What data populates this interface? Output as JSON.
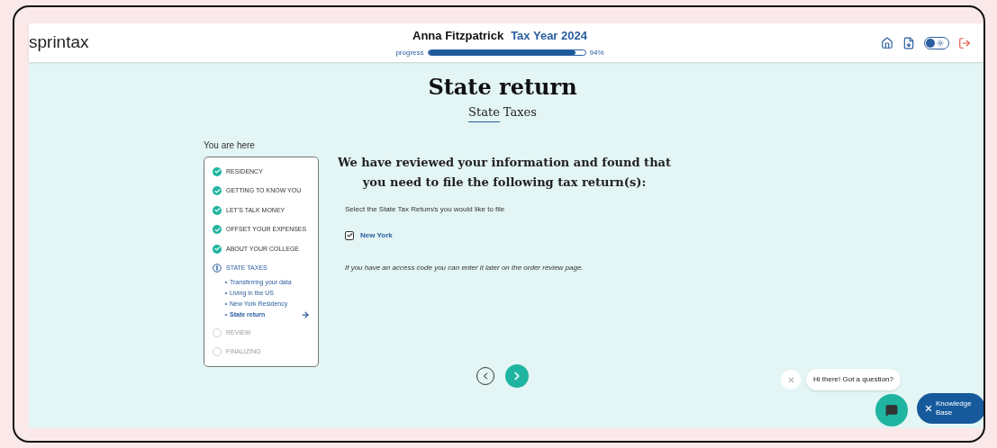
{
  "header": {
    "logo": "sprintax",
    "user_name": "Anna Fitzpatrick",
    "tax_year": "Tax Year 2024",
    "progress_label": "progress",
    "progress": {
      "level": 0.94
    },
    "progress_reading": "94%",
    "theme_toggle": {
      "on": false
    }
  },
  "sidebar": {
    "title": "You are here",
    "steps": [
      {
        "label": "RESIDENCY",
        "kind": "done"
      },
      {
        "label": "GETTING TO KNOW YOU",
        "kind": "done"
      },
      {
        "label": "LET'S TALK MONEY",
        "kind": "done"
      },
      {
        "label": "OFFSET YOUR EXPENSES",
        "kind": "done"
      },
      {
        "label": "ABOUT YOUR COLLEGE",
        "kind": "done"
      },
      {
        "label": "STATE TAXES",
        "kind": "current",
        "children": [
          {
            "label": "Transferring your data",
            "selected": false
          },
          {
            "label": "Living in the US",
            "selected": false
          },
          {
            "label": "New York Residency",
            "selected": false
          },
          {
            "label": "State return",
            "selected": true
          }
        ]
      },
      {
        "label": "REVIEW",
        "kind": "pending"
      },
      {
        "label": "FINALIZING",
        "kind": "pending"
      }
    ]
  },
  "main": {
    "title": "State return",
    "subtitle_underlined": "State",
    "subtitle_rest": "Taxes",
    "heading": "We have reviewed your information and found that you need to file the following tax return(s):",
    "instruction": "Select the State Tax Return/s you would like to file",
    "options": [
      {
        "label": "New York",
        "checked": true
      }
    ],
    "note": "If you have an access code you can enter it later on the order review page."
  },
  "chat": {
    "greeting": "Hi there! Got a question?",
    "knowledge_base": "Knowledge Base"
  }
}
